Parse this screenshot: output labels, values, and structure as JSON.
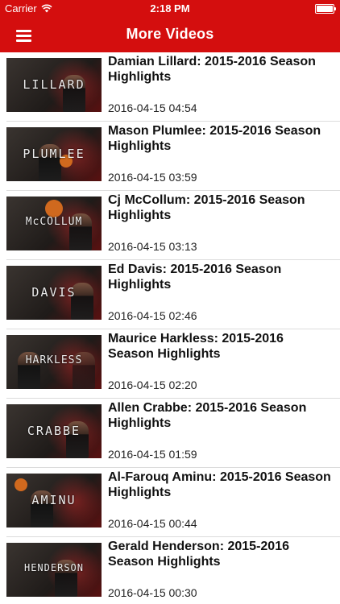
{
  "status_bar": {
    "carrier": "Carrier",
    "time": "2:18 PM"
  },
  "nav": {
    "title": "More Videos"
  },
  "videos": [
    {
      "title": "Damian Lillard: 2015-2016 Season Highlights",
      "date": "2016-04-15 04:54",
      "thumb_text": "LILLARD"
    },
    {
      "title": "Mason Plumlee: 2015-2016 Season Highlights",
      "date": "2016-04-15 03:59",
      "thumb_text": "PLUMLEE"
    },
    {
      "title": "Cj McCollum: 2015-2016 Season Highlights",
      "date": "2016-04-15 03:13",
      "thumb_text": "McCOLLUM"
    },
    {
      "title": "Ed Davis: 2015-2016 Season Highlights",
      "date": "2016-04-15 02:46",
      "thumb_text": "DAVIS"
    },
    {
      "title": "Maurice Harkless: 2015-2016 Season Highlights",
      "date": "2016-04-15 02:20",
      "thumb_text": "HARKLESS"
    },
    {
      "title": "Allen Crabbe: 2015-2016 Season Highlights",
      "date": "2016-04-15 01:59",
      "thumb_text": "CRABBE"
    },
    {
      "title": "Al-Farouq Aminu: 2015-2016 Season Highlights",
      "date": "2016-04-15 00:44",
      "thumb_text": "AMINU"
    },
    {
      "title": "Gerald Henderson: 2015-2016 Season Highlights",
      "date": "2016-04-15 00:30",
      "thumb_text": "HENDERSON"
    }
  ],
  "colors": {
    "nav_red": "#d40e0e",
    "separator": "#dcdcdc"
  },
  "icons": {
    "menu": "hamburger-menu-icon",
    "wifi": "wifi-icon",
    "battery": "battery-icon"
  }
}
